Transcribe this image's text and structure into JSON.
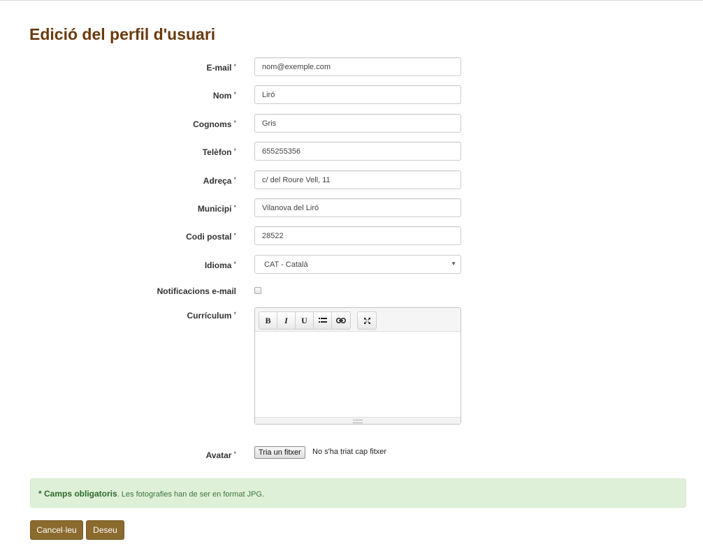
{
  "page_title": "Edició del perfil d'usuari",
  "required_marker": "*",
  "fields": {
    "email": {
      "label": "E-mail",
      "value": "nom@exemple.com"
    },
    "nom": {
      "label": "Nom",
      "value": "Liró"
    },
    "cognoms": {
      "label": "Cognoms",
      "value": "Gris"
    },
    "telefon": {
      "label": "Telèfon",
      "value": "655255356"
    },
    "adreca": {
      "label": "Adreça",
      "value": "c/ del Roure Vell, 11"
    },
    "municipi": {
      "label": "Municipi",
      "value": "Vilanova del Liró"
    },
    "codi_postal": {
      "label": "Codi postal",
      "value": "28522"
    },
    "idioma": {
      "label": "Idioma",
      "value": "CAT - Català"
    },
    "notificacions": {
      "label": "Notificacions e-mail",
      "checked": false
    },
    "curriculum": {
      "label": "Currículum",
      "value": ""
    },
    "avatar": {
      "label": "Avatar",
      "button": "Tria un fitxer",
      "status": "No s'ha triat cap fitxer"
    }
  },
  "editor_toolbar": {
    "bold": "B",
    "italic": "I",
    "underline": "U",
    "list_icon": "list-icon",
    "link_icon": "link-icon",
    "fullscreen_icon": "fullscreen-icon"
  },
  "alert": {
    "strong": "* Camps obligatoris",
    "text": ". Les fotografies han de ser en format JPG."
  },
  "buttons": {
    "cancel": "Cancel·leu",
    "save": "Deseu"
  },
  "colors": {
    "title": "#6b3a0d",
    "button_bg": "#8b6a2e",
    "alert_bg": "#dff0d8",
    "alert_text": "#3c763d"
  }
}
